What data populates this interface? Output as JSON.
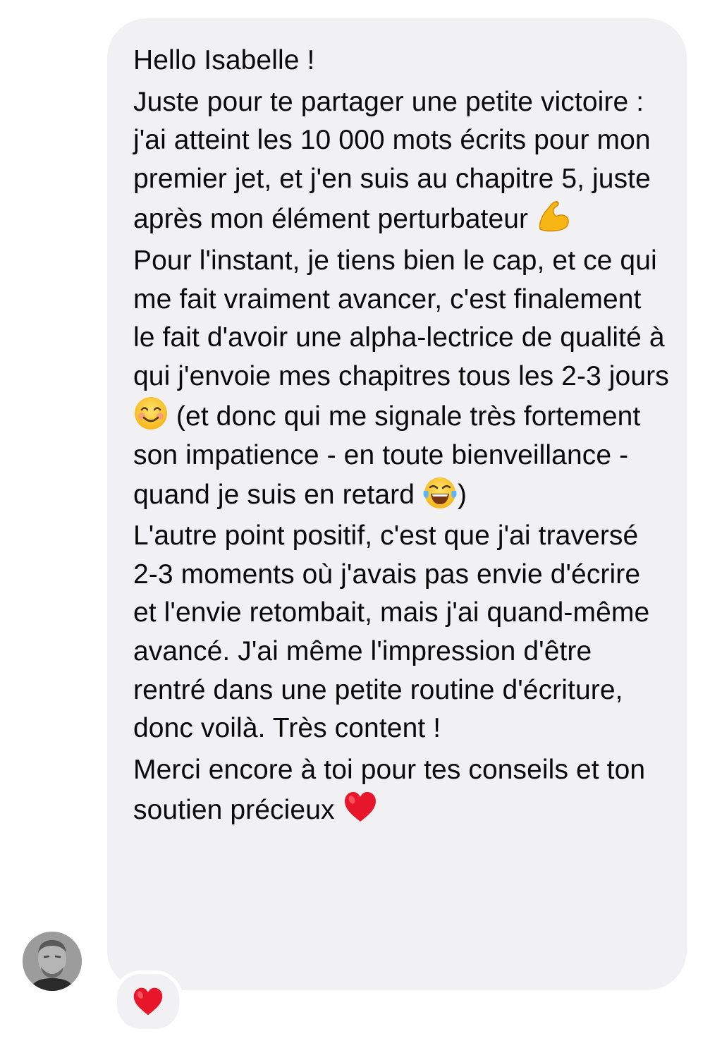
{
  "message": {
    "greeting": "Hello Isabelle !",
    "para2_text": "Juste pour te partager une petite victoire : j'ai atteint les 10 000 mots écrits pour mon premier jet, et j'en suis au chapitre 5, juste après mon élément perturbateur ",
    "para3_part1": "Pour l'instant, je tiens bien le cap, et ce qui me fait vraiment avancer, c'est finalement le fait d'avoir une alpha-lectrice de qualité à qui j'envoie mes chapitres tous les 2-3 jours ",
    "para3_part2": " (et donc qui me signale très fortement son impatience - en toute bienveillance - quand je suis en retard ",
    "para3_part3": ")",
    "para4_text": "L'autre point positif, c'est que j'ai traversé 2-3 moments où j'avais pas envie d'écrire et l'envie retombait, mais j'ai quand-même avancé. J'ai même l'impression d'être rentré dans une petite routine d'écriture, donc voilà. Très content !",
    "para5_text": "Merci encore à toi pour tes conseils et ton soutien précieux "
  },
  "icons": {
    "muscle": "flexed-biceps-emoji",
    "smile": "smiling-face-emoji",
    "laugh": "tears-of-joy-emoji",
    "heart": "red-heart-emoji",
    "reaction": "red-heart-reaction"
  },
  "colors": {
    "bubble": "#f1f1f4",
    "text": "#0a0a0a",
    "heart": "#e8162b"
  }
}
